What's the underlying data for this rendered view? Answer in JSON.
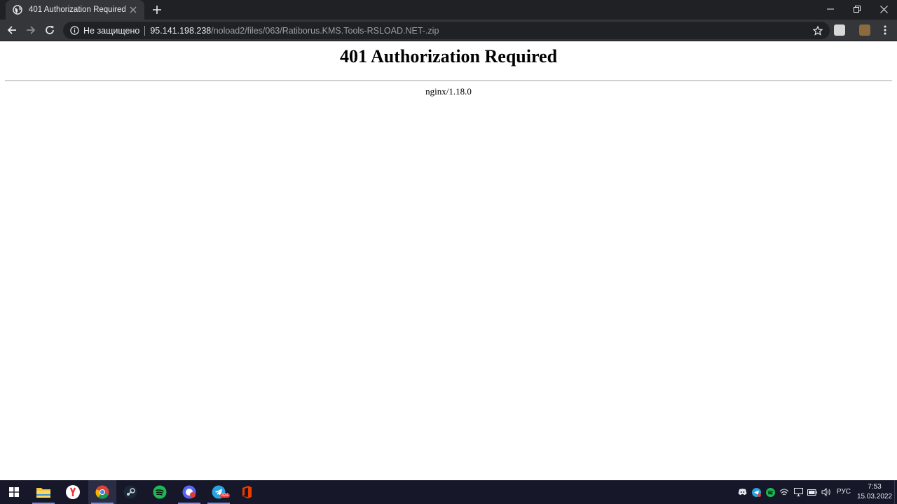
{
  "browser": {
    "tab": {
      "title": "401 Authorization Required"
    },
    "address_bar": {
      "security_label": "Не защищено",
      "url_host": "95.141.198.238",
      "url_path": "/noload2/files/063/Ratiborus.KMS.Tools-RSLOAD.NET-.zip"
    }
  },
  "page": {
    "heading": "401 Authorization Required",
    "server_signature": "nginx/1.18.0"
  },
  "taskbar": {
    "apps": [
      "start-icon",
      "file-explorer-icon",
      "yandex-browser-icon",
      "chrome-icon",
      "steam-icon",
      "spotify-icon",
      "game-launcher-icon",
      "telegram-icon",
      "office-icon"
    ],
    "telegram_badge": "424",
    "language": "РУС",
    "time": "7:53",
    "date": "15.03.2022"
  },
  "colors": {
    "tabstrip": "#202124",
    "toolbar": "#35363a",
    "taskbar": "#16182a",
    "url_host": "#e8eaed",
    "url_path": "#9aa0a6"
  }
}
